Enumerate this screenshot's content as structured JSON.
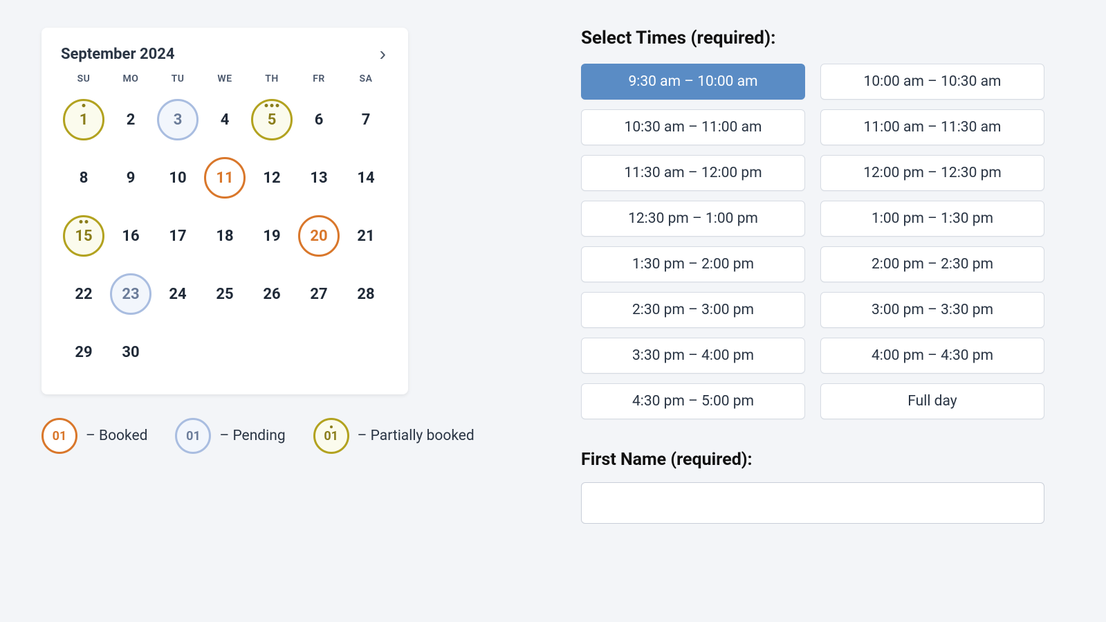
{
  "calendar": {
    "title": "September 2024",
    "next_symbol": "›",
    "weekdays": [
      "SU",
      "MO",
      "TU",
      "WE",
      "TH",
      "FR",
      "SA"
    ],
    "days": [
      {
        "n": "1",
        "status": "partial",
        "dots": 1
      },
      {
        "n": "2"
      },
      {
        "n": "3",
        "status": "pending"
      },
      {
        "n": "4"
      },
      {
        "n": "5",
        "status": "partial",
        "dots": 3
      },
      {
        "n": "6"
      },
      {
        "n": "7"
      },
      {
        "n": "8"
      },
      {
        "n": "9"
      },
      {
        "n": "10"
      },
      {
        "n": "11",
        "status": "booked"
      },
      {
        "n": "12"
      },
      {
        "n": "13"
      },
      {
        "n": "14"
      },
      {
        "n": "15",
        "status": "partial",
        "dots": 2
      },
      {
        "n": "16"
      },
      {
        "n": "17"
      },
      {
        "n": "18"
      },
      {
        "n": "19"
      },
      {
        "n": "20",
        "status": "booked"
      },
      {
        "n": "21"
      },
      {
        "n": "22"
      },
      {
        "n": "23",
        "status": "pending"
      },
      {
        "n": "24"
      },
      {
        "n": "25"
      },
      {
        "n": "26"
      },
      {
        "n": "27"
      },
      {
        "n": "28"
      },
      {
        "n": "29"
      },
      {
        "n": "30"
      }
    ]
  },
  "legend": {
    "badge_text": "01",
    "booked": "– Booked",
    "pending": "– Pending",
    "partial": "– Partially booked"
  },
  "times": {
    "title": "Select Times (required):",
    "slots": [
      {
        "label": "9:30 am – 10:00 am",
        "selected": true
      },
      {
        "label": "10:00 am – 10:30 am"
      },
      {
        "label": "10:30 am – 11:00 am"
      },
      {
        "label": "11:00 am – 11:30 am"
      },
      {
        "label": "11:30 am – 12:00 pm"
      },
      {
        "label": "12:00 pm – 12:30 pm"
      },
      {
        "label": "12:30 pm – 1:00 pm"
      },
      {
        "label": "1:00 pm – 1:30 pm"
      },
      {
        "label": "1:30 pm – 2:00 pm"
      },
      {
        "label": "2:00 pm – 2:30 pm"
      },
      {
        "label": "2:30 pm – 3:00 pm"
      },
      {
        "label": "3:00 pm – 3:30 pm"
      },
      {
        "label": "3:30 pm – 4:00 pm"
      },
      {
        "label": "4:00 pm – 4:30 pm"
      },
      {
        "label": "4:30 pm – 5:00 pm"
      },
      {
        "label": "Full day"
      }
    ]
  },
  "fname": {
    "label": "First Name (required):",
    "value": ""
  }
}
